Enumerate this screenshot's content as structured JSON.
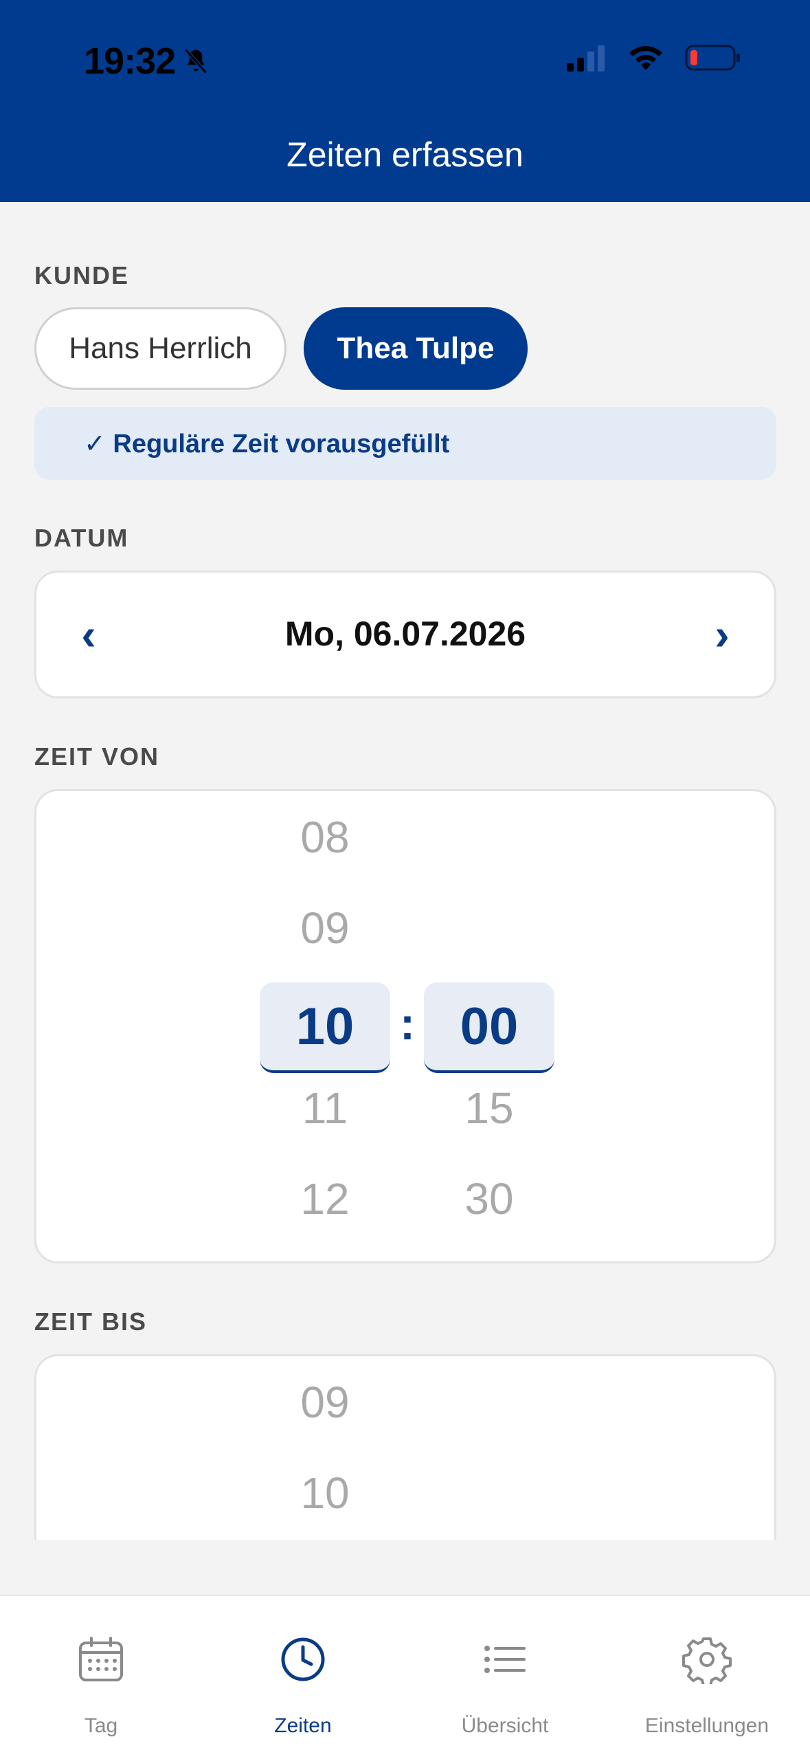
{
  "status_bar": {
    "time": "19:32"
  },
  "header": {
    "title": "Zeiten erfassen"
  },
  "kunde": {
    "label": "KUNDE",
    "chips": [
      "Hans Herrlich",
      "Thea Tulpe"
    ],
    "selected": "Thea Tulpe",
    "banner": "✓ Reguläre Zeit vorausgefüllt"
  },
  "datum": {
    "label": "DATUM",
    "value": "Mo, 06.07.2026",
    "prev": "‹",
    "next": "›"
  },
  "zeit_von": {
    "label": "ZEIT VON",
    "hours": [
      "08",
      "09",
      "10",
      "11",
      "12"
    ],
    "minutes": [
      "00",
      "15",
      "30"
    ],
    "selected_hour": "10",
    "selected_minute": "00",
    "separator": ":"
  },
  "zeit_bis": {
    "label": "ZEIT BIS",
    "hours": [
      "09",
      "10"
    ]
  },
  "nav": {
    "items": [
      {
        "label": "Tag",
        "icon": "calendar-icon"
      },
      {
        "label": "Zeiten",
        "icon": "clock-icon"
      },
      {
        "label": "Übersicht",
        "icon": "list-icon"
      },
      {
        "label": "Einstellungen",
        "icon": "gear-icon"
      }
    ],
    "active": "Zeiten"
  },
  "colors": {
    "brand": "#003b90",
    "accent": "#0a3b86",
    "muted": "#a9a9a9"
  }
}
